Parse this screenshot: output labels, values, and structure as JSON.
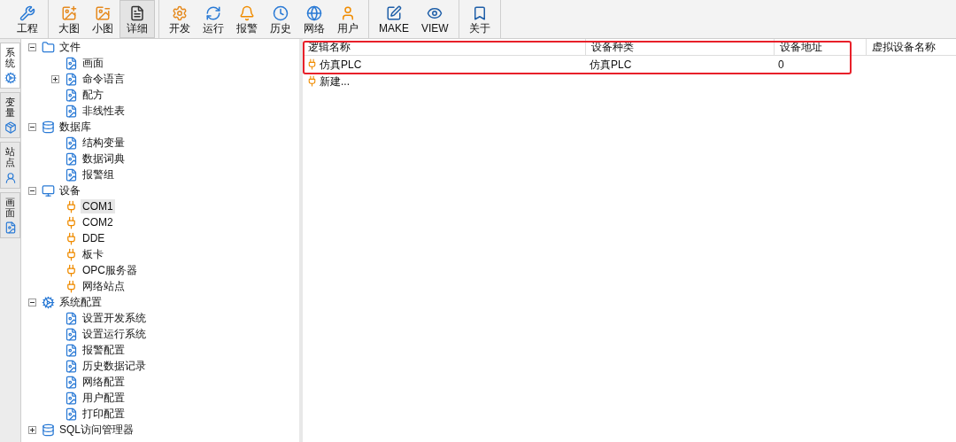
{
  "toolbar": {
    "groups": [
      [
        {
          "label": "工程",
          "selected": false
        }
      ],
      [
        {
          "label": "大图",
          "selected": false
        },
        {
          "label": "小图",
          "selected": false
        },
        {
          "label": "详细",
          "selected": true
        }
      ],
      [
        {
          "label": "开发",
          "selected": false
        },
        {
          "label": "运行",
          "selected": false
        },
        {
          "label": "报警",
          "selected": false
        },
        {
          "label": "历史",
          "selected": false
        },
        {
          "label": "网络",
          "selected": false
        },
        {
          "label": "用户",
          "selected": false
        }
      ],
      [
        {
          "label": "MAKE",
          "selected": false
        },
        {
          "label": "VIEW",
          "selected": false
        }
      ],
      [
        {
          "label": "关于",
          "selected": false
        }
      ]
    ]
  },
  "side_tabs": [
    {
      "label": "系统",
      "selected": true
    },
    {
      "label": "变量",
      "selected": false
    },
    {
      "label": "站点",
      "selected": false
    },
    {
      "label": "画面",
      "selected": false
    }
  ],
  "tree": [
    {
      "label": "文件",
      "expanded": true,
      "selected": false,
      "children": [
        {
          "label": "画面",
          "selected": false
        },
        {
          "label": "命令语言",
          "expanded": false,
          "selected": false
        },
        {
          "label": "配方",
          "selected": false
        },
        {
          "label": "非线性表",
          "selected": false
        }
      ]
    },
    {
      "label": "数据库",
      "expanded": true,
      "selected": false,
      "children": [
        {
          "label": "结构变量",
          "selected": false
        },
        {
          "label": "数据词典",
          "selected": false
        },
        {
          "label": "报警组",
          "selected": false
        }
      ]
    },
    {
      "label": "设备",
      "expanded": true,
      "selected": false,
      "children": [
        {
          "label": "COM1",
          "selected": true
        },
        {
          "label": "COM2",
          "selected": false
        },
        {
          "label": "DDE",
          "selected": false
        },
        {
          "label": "板卡",
          "selected": false
        },
        {
          "label": "OPC服务器",
          "selected": false
        },
        {
          "label": "网络站点",
          "selected": false
        }
      ]
    },
    {
      "label": "系统配置",
      "expanded": true,
      "selected": false,
      "children": [
        {
          "label": "设置开发系统",
          "selected": false
        },
        {
          "label": "设置运行系统",
          "selected": false
        },
        {
          "label": "报警配置",
          "selected": false
        },
        {
          "label": "历史数据记录",
          "selected": false
        },
        {
          "label": "网络配置",
          "selected": false
        },
        {
          "label": "用户配置",
          "selected": false
        },
        {
          "label": "打印配置",
          "selected": false
        }
      ]
    },
    {
      "label": "SQL访问管理器",
      "expanded": false,
      "selected": false
    }
  ],
  "table": {
    "columns": [
      "逻辑名称",
      "设备种类",
      "设备地址",
      "虚拟设备名称"
    ],
    "rows": [
      {
        "cells": [
          "仿真PLC",
          "仿真PLC",
          "0"
        ]
      },
      {
        "cells": [
          "新建..."
        ]
      }
    ]
  }
}
